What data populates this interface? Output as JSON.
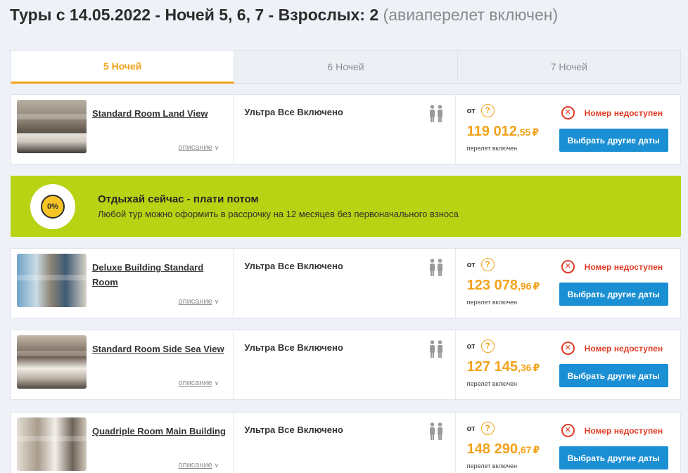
{
  "header": {
    "title": "Туры с 14.05.2022 - Ночей 5, 6, 7 - Взрослых: 2",
    "subtitle": "(авиаперелет включен)"
  },
  "tabs": [
    {
      "label": "5 Ночей",
      "active": true
    },
    {
      "label": "6 Ночей",
      "active": false
    },
    {
      "label": "7 Ночей",
      "active": false
    }
  ],
  "promo": {
    "badge": "0%",
    "title": "Отдыхай сейчас - плати потом",
    "subtitle": "Любой тур можно оформить в рассрочку на 12 месяцев без первоначального взноса"
  },
  "rooms": [
    {
      "name": "Standard Room Land View",
      "desc_link": "описание",
      "meal": "Ультра Все Включено",
      "price_from": "от",
      "price_main": "119 012",
      "price_cents": ",55",
      "currency": "₽",
      "flight_note": "перелет включен",
      "status": "Номер недоступен",
      "button": "Выбрать другие даты"
    },
    {
      "name": "Deluxe Building Standard Room",
      "desc_link": "описание",
      "meal": "Ультра Все Включено",
      "price_from": "от",
      "price_main": "123 078",
      "price_cents": ",96",
      "currency": "₽",
      "flight_note": "перелет включен",
      "status": "Номер недоступен",
      "button": "Выбрать другие даты"
    },
    {
      "name": "Standard Room Side Sea View",
      "desc_link": "описание",
      "meal": "Ультра Все Включено",
      "price_from": "от",
      "price_main": "127 145",
      "price_cents": ",36",
      "currency": "₽",
      "flight_note": "перелет включен",
      "status": "Номер недоступен",
      "button": "Выбрать другие даты"
    },
    {
      "name": "Quadriple Room Main Building",
      "desc_link": "описание",
      "meal": "Ультра Все Включено",
      "price_from": "от",
      "price_main": "148 290",
      "price_cents": ",67",
      "currency": "₽",
      "flight_note": "перелет включен",
      "status": "Номер недоступен",
      "button": "Выбрать другие даты"
    }
  ],
  "icons": {
    "guests": "two-adults-icon",
    "help": "question-circle-icon",
    "unavailable": "x-circle-icon",
    "chevron": "chevron-down-icon",
    "promo": "zero-percent-badge-icon"
  },
  "colors": {
    "accent": "#f2a31b",
    "button": "#1a8fd3",
    "error": "#e03b24",
    "promo_bg": "#b7d313"
  }
}
